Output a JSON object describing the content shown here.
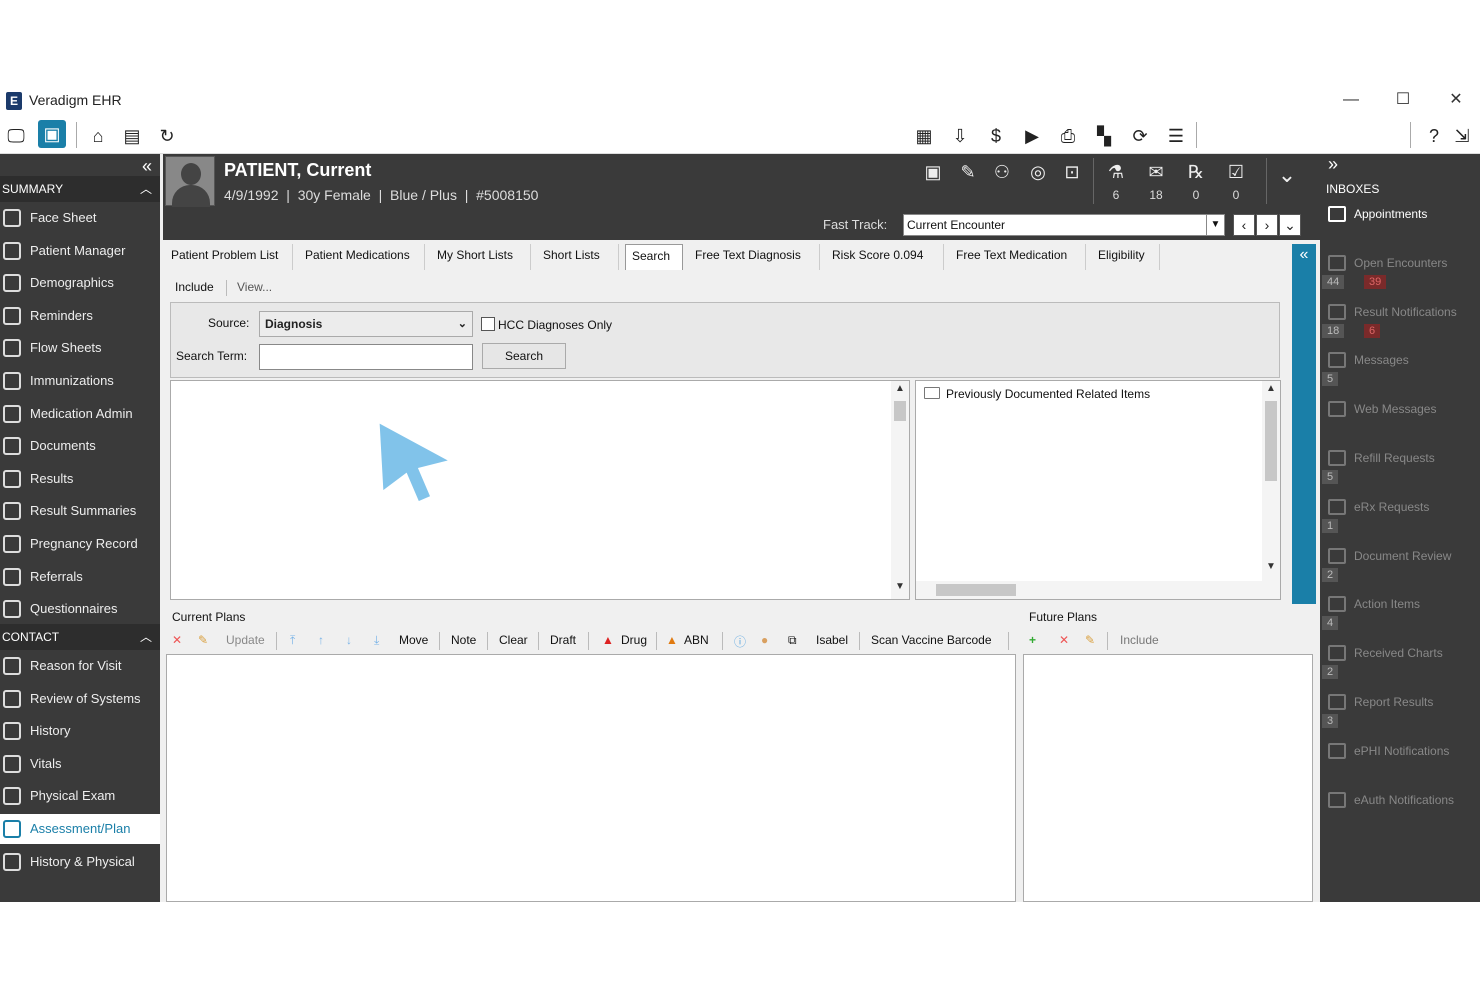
{
  "app": {
    "title": "Veradigm EHR",
    "logo_letter": "E"
  },
  "window_controls": {
    "minimize": "—",
    "maximize": "☐",
    "close": "✕"
  },
  "toolbar": {
    "left_icons": [
      "monitor-icon",
      "patient-badge-icon",
      "home-icon",
      "clipboard-icon",
      "refresh-icon"
    ],
    "right_icons": [
      "calendar-icon",
      "inbox-icon",
      "dollar-icon",
      "play-icon",
      "printer-icon",
      "apps-icon",
      "sync-icon",
      "menu-icon",
      "help-icon",
      "export-icon"
    ]
  },
  "left_nav": {
    "collapse_glyph": "«",
    "summary_label": "SUMMARY",
    "summary_items": [
      {
        "label": "Face Sheet",
        "icon": "face-sheet-icon"
      },
      {
        "label": "Patient Manager",
        "icon": "patient-manager-icon"
      },
      {
        "label": "Demographics",
        "icon": "demographics-icon"
      },
      {
        "label": "Reminders",
        "icon": "bell-icon"
      },
      {
        "label": "Flow Sheets",
        "icon": "flow-sheet-icon"
      },
      {
        "label": "Immunizations",
        "icon": "syringe-icon"
      },
      {
        "label": "Medication Admin",
        "icon": "medication-icon"
      },
      {
        "label": "Documents",
        "icon": "document-icon"
      },
      {
        "label": "Results",
        "icon": "results-icon"
      },
      {
        "label": "Result Summaries",
        "icon": "bar-chart-icon"
      },
      {
        "label": "Pregnancy Record",
        "icon": "pregnancy-icon"
      },
      {
        "label": "Referrals",
        "icon": "referral-icon"
      },
      {
        "label": "Questionnaires",
        "icon": "questionnaire-icon"
      }
    ],
    "contact_label": "CONTACT",
    "contact_items": [
      {
        "label": "Reason for Visit",
        "icon": "info-icon"
      },
      {
        "label": "Review of Systems",
        "icon": "list-icon"
      },
      {
        "label": "History",
        "icon": "history-icon"
      },
      {
        "label": "Vitals",
        "icon": "heart-icon"
      },
      {
        "label": "Physical Exam",
        "icon": "stethoscope-icon"
      },
      {
        "label": "Assessment/Plan",
        "icon": "assessment-icon",
        "active": true
      },
      {
        "label": "History & Physical",
        "icon": "hp-icon"
      }
    ]
  },
  "patient": {
    "name": "PATIENT, Current",
    "info": "4/9/1992  |  30y Female  |  Blue / Plus  |  #5008150",
    "counters": [
      {
        "icon": "flask-icon",
        "count": "6"
      },
      {
        "icon": "mail-icon",
        "count": "18"
      },
      {
        "icon": "rx-icon",
        "count": "0"
      },
      {
        "icon": "task-check-icon",
        "count": "0"
      }
    ]
  },
  "fast_track": {
    "label": "Fast Track:",
    "value": "Current Encounter"
  },
  "tabs": [
    "Patient Problem List",
    "Patient Medications",
    "My Short Lists",
    "Short Lists",
    "Search",
    "Free Text Diagnosis",
    "Risk Score  0.094",
    "Free Text Medication",
    "Eligibility"
  ],
  "active_tab": "Search",
  "subtabs": {
    "include": "Include",
    "view": "View..."
  },
  "search": {
    "source_label": "Source:",
    "source_value": "Diagnosis",
    "hcc_label": "HCC Diagnoses Only",
    "term_label": "Search Term:",
    "term_value": "",
    "button_label": "Search"
  },
  "related": {
    "title": "Previously Documented Related Items"
  },
  "current_plans": {
    "title": "Current Plans",
    "toolbar": [
      "Update",
      "Move",
      "Note",
      "Clear",
      "Draft",
      "Drug",
      "ABN",
      "Isabel",
      "Scan Vaccine Barcode"
    ]
  },
  "future_plans": {
    "title": "Future Plans",
    "toolbar": [
      "Include"
    ]
  },
  "inboxes": {
    "title": "INBOXES",
    "collapse_glyph": "»",
    "items": [
      {
        "label": "Appointments",
        "icon": "calendar-icon",
        "bright": true,
        "badges": []
      },
      {
        "label": "Open Encounters",
        "icon": "encounter-icon",
        "badges": [
          "44",
          "39"
        ]
      },
      {
        "label": "Result Notifications",
        "icon": "result-notification-icon",
        "badges": [
          "18",
          "6"
        ]
      },
      {
        "label": "Messages",
        "icon": "envelope-icon",
        "badges": [
          "5"
        ]
      },
      {
        "label": "Web Messages",
        "icon": "globe-icon",
        "badges": []
      },
      {
        "label": "Refill Requests",
        "icon": "refill-icon",
        "badges": [
          "5"
        ]
      },
      {
        "label": "eRx Requests",
        "icon": "erx-icon",
        "badges": [
          "1"
        ]
      },
      {
        "label": "Document Review",
        "icon": "doc-review-icon",
        "badges": [
          "2"
        ]
      },
      {
        "label": "Action Items",
        "icon": "action-items-icon",
        "badges": [
          "4"
        ]
      },
      {
        "label": "Received Charts",
        "icon": "chart-icon",
        "badges": [
          "2"
        ]
      },
      {
        "label": "Report Results",
        "icon": "pie-icon",
        "badges": [
          "3"
        ]
      },
      {
        "label": "ePHI Notifications",
        "icon": "ephi-icon",
        "badges": []
      },
      {
        "label": "eAuth Notifications",
        "icon": "eauth-icon",
        "badges": []
      }
    ]
  }
}
